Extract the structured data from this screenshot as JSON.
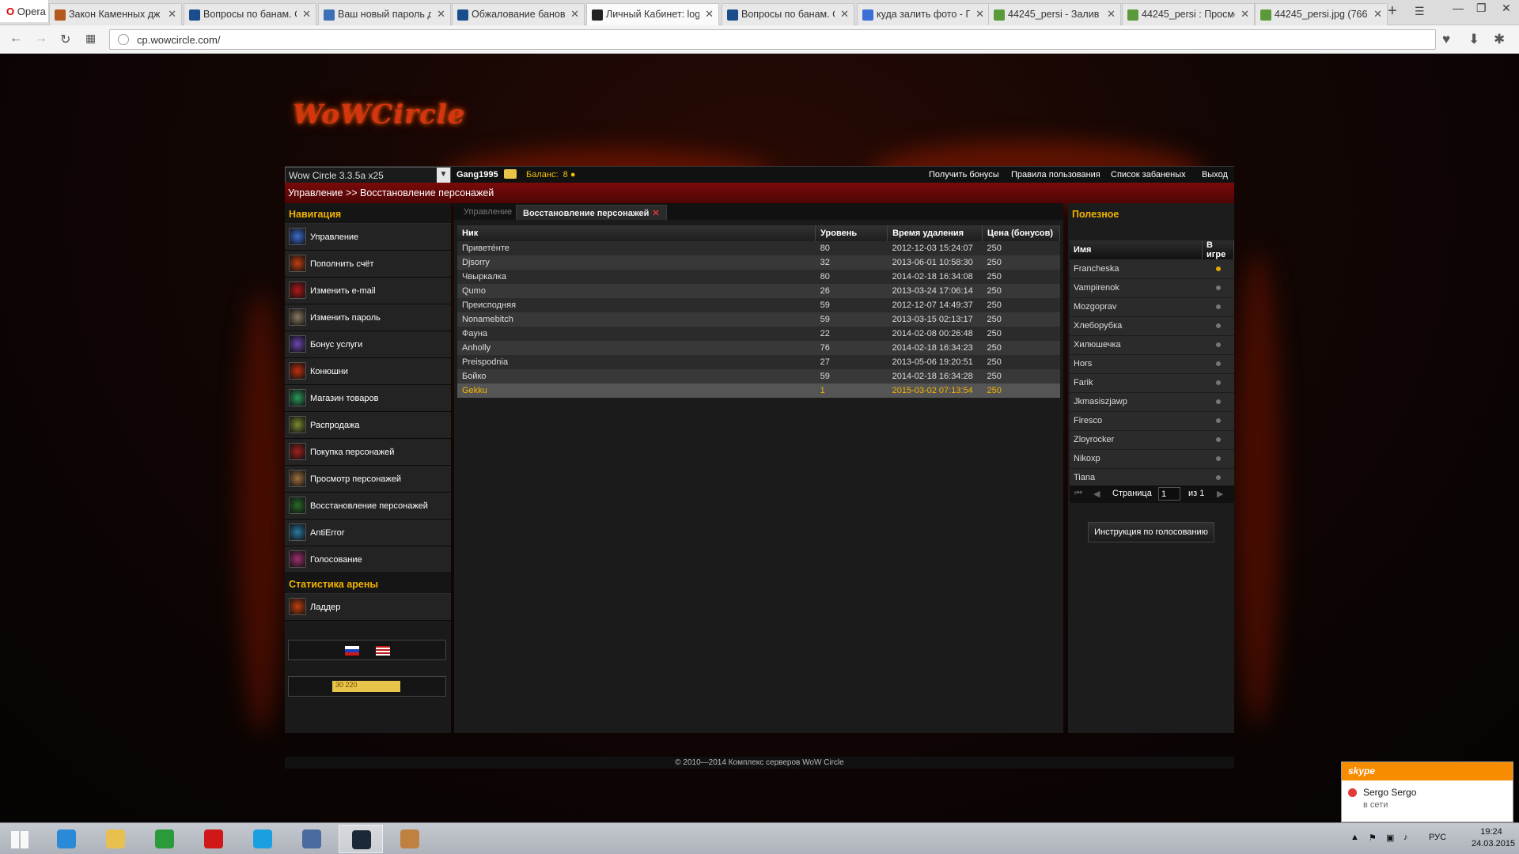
{
  "browser": {
    "opera_label": "Opera",
    "tabs": [
      {
        "title": "Закон Каменных дж",
        "color": "#b35a1e"
      },
      {
        "title": "Вопросы по банам. С",
        "color": "#1a4d8c"
      },
      {
        "title": "Ваш новый пароль д",
        "color": "#3b6fb6"
      },
      {
        "title": "Обжалование банов",
        "color": "#1a4d8c"
      },
      {
        "title": "Личный Кабинет: log",
        "color": "#222"
      },
      {
        "title": "Вопросы по банам. С",
        "color": "#1a4d8c"
      },
      {
        "title": "куда залить фото - Г",
        "color": "#3b6fd6"
      },
      {
        "title": "44245_persi - Залив",
        "color": "#5a9a3a"
      },
      {
        "title": "44245_persi : Просмо",
        "color": "#5a9a3a"
      },
      {
        "title": "44245_persi.jpg (766",
        "color": "#5a9a3a"
      }
    ],
    "active_tab_index": 4,
    "url": "cp.wowcircle.com/"
  },
  "site": {
    "logo": "WoWCircle",
    "realm": "Wow Circle 3.3.5a x25",
    "username": "Gang1995",
    "balance_label": "Баланс:",
    "balance_value": "8",
    "links": [
      "Получить бонусы",
      "Правила пользования",
      "Список забаненых",
      "Выход"
    ],
    "breadcrumb": "Управление >> Восстановление персонажей"
  },
  "nav": {
    "title": "Навигация",
    "items": [
      {
        "label": "Управление",
        "color": "#3b6fd0"
      },
      {
        "label": "Пополнить счёт",
        "color": "#c04010"
      },
      {
        "label": "Изменить e-mail",
        "color": "#b01818"
      },
      {
        "label": "Изменить пароль",
        "color": "#8a7a60"
      },
      {
        "label": "Бонус услуги",
        "color": "#6a48b0"
      },
      {
        "label": "Конюшни",
        "color": "#c03010"
      },
      {
        "label": "Магазин товаров",
        "color": "#2a9a5a"
      },
      {
        "label": "Распродажа",
        "color": "#7a8a30"
      },
      {
        "label": "Покупка персонажей",
        "color": "#a02020"
      },
      {
        "label": "Просмотр персонажей",
        "color": "#a07040"
      },
      {
        "label": "Восстановление персонажей",
        "color": "#2a6a2a"
      },
      {
        "label": "AntiError",
        "color": "#2a7aa0"
      },
      {
        "label": "Голосование",
        "color": "#a03070"
      }
    ],
    "arena_title": "Статистика арены",
    "arena_items": [
      {
        "label": "Ладдер",
        "color": "#c04010"
      }
    ],
    "counter_badge": "30 220"
  },
  "main": {
    "tab_parent": "Управление",
    "tab_active": "Восстановление персонажей",
    "columns": [
      "Ник",
      "Уровень",
      "Время удаления",
      "Цена (бонусов)"
    ],
    "rows": [
      [
        "Приветéнте",
        "80",
        "2012-12-03 15:24:07",
        "250"
      ],
      [
        "Djsorry",
        "32",
        "2013-06-01 10:58:30",
        "250"
      ],
      [
        "Чвыркалка",
        "80",
        "2014-02-18 16:34:08",
        "250"
      ],
      [
        "Qumo",
        "26",
        "2013-03-24 17:06:14",
        "250"
      ],
      [
        "Преисподняя",
        "59",
        "2012-12-07 14:49:37",
        "250"
      ],
      [
        "Nonamebitch",
        "59",
        "2013-03-15 02:13:17",
        "250"
      ],
      [
        "Фауна",
        "22",
        "2014-02-08 00:26:48",
        "250"
      ],
      [
        "Anholly",
        "76",
        "2014-02-18 16:34:23",
        "250"
      ],
      [
        "Preispodnia",
        "27",
        "2013-05-06 19:20:51",
        "250"
      ],
      [
        "Бойко",
        "59",
        "2014-02-18 16:34:28",
        "250"
      ],
      [
        "Gekku",
        "1",
        "2015-03-02 07:13:54",
        "250"
      ]
    ],
    "selected_row_index": 10
  },
  "useful": {
    "title": "Полезное",
    "columns": [
      "Имя",
      "В игре"
    ],
    "players": [
      {
        "name": "Francheska",
        "online": true
      },
      {
        "name": "Vampirenok",
        "online": false
      },
      {
        "name": "Mozgoprav",
        "online": false
      },
      {
        "name": "Хлеборубка",
        "online": false
      },
      {
        "name": "Хилюшечка",
        "online": false
      },
      {
        "name": "Hors",
        "online": false
      },
      {
        "name": "Farik",
        "online": false
      },
      {
        "name": "Jkmasiszjawp",
        "online": false
      },
      {
        "name": "Firesco",
        "online": false
      },
      {
        "name": "Zloyrocker",
        "online": false
      },
      {
        "name": "Nikoxp",
        "online": false
      },
      {
        "name": "Tiana",
        "online": false
      }
    ],
    "pager_label": "Страница",
    "pager_value": "1",
    "pager_of": "из 1",
    "vote_button": "Инструкция по голосованию"
  },
  "footer": "© 2010—2014 Комплекс серверов WoW Circle",
  "skype": {
    "brand": "skype",
    "name": "Sergo Sergo",
    "status": "в сети"
  },
  "taskbar": {
    "apps": [
      {
        "name": "ie-icon",
        "color": "#2a8ad8"
      },
      {
        "name": "explorer-icon",
        "color": "#e8c050"
      },
      {
        "name": "store-icon",
        "color": "#2a9a3a"
      },
      {
        "name": "opera-icon",
        "color": "#d01818"
      },
      {
        "name": "skype-icon",
        "color": "#1aa0e0"
      },
      {
        "name": "launcher-icon",
        "color": "#4a6aa0"
      },
      {
        "name": "steam-icon",
        "color": "#1b2838"
      },
      {
        "name": "paint-icon",
        "color": "#c08040"
      }
    ],
    "active_app_index": 6,
    "lang": "РУС",
    "time": "19:24",
    "date": "24.03.2015"
  }
}
